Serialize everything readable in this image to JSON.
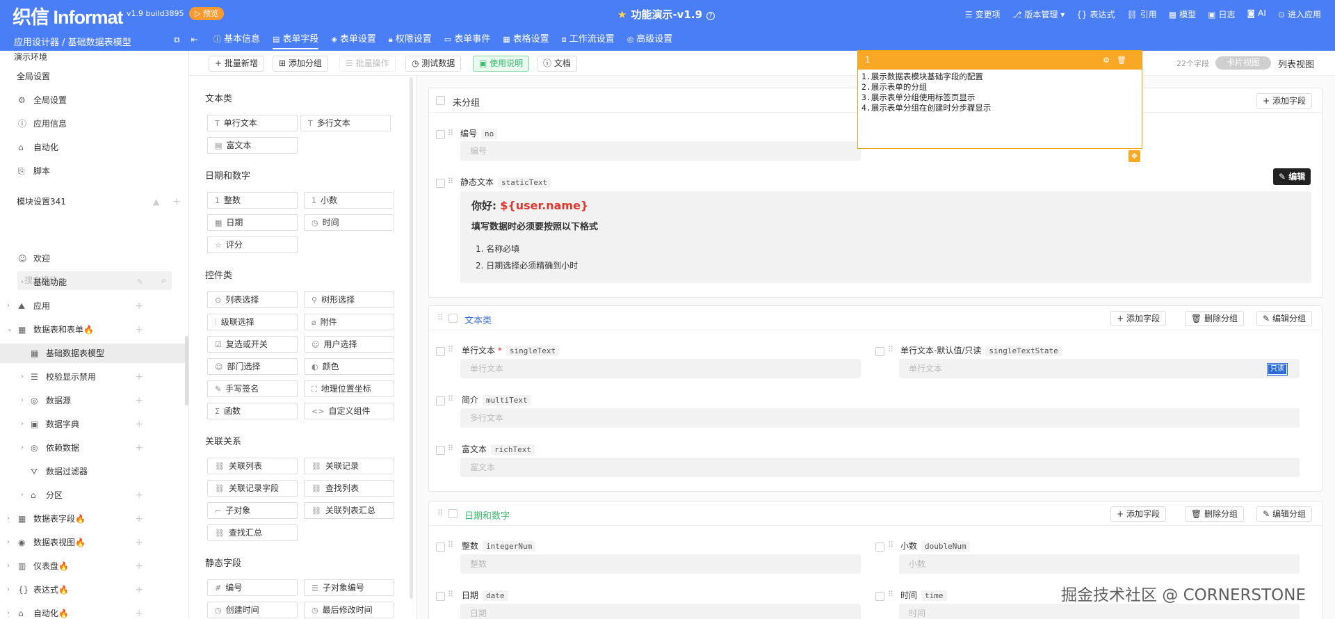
{
  "header": {
    "logo": "织信 Informat",
    "version": "v1.9 build3895",
    "preview_badge": "▷ 预览",
    "center_title": "功能演示-v1.9",
    "nav": [
      "变更项",
      "版本管理 ▾",
      "表达式",
      "引用",
      "模型",
      "日志",
      "AI",
      "进入应用"
    ]
  },
  "subbar": {
    "breadcrumb": "应用设计器 / 基础数据表模型",
    "tabs": [
      "基本信息",
      "表单字段",
      "表单设置",
      "权限设置",
      "表单事件",
      "表格设置",
      "工作流设置",
      "高级设置"
    ]
  },
  "sidebar": {
    "env": "演示环境",
    "global_settings": "全局设置",
    "global_items": [
      "全局设置",
      "应用信息",
      "自动化",
      "脚本"
    ],
    "module_settings": "模块设置341",
    "search_placeholder": "搜索模块",
    "modules": [
      {
        "label": "欢迎"
      },
      {
        "label": "基础功能"
      },
      {
        "label": "应用"
      },
      {
        "label": "数据表和表单🔥"
      },
      {
        "label": "基础数据表模型"
      },
      {
        "label": "校验显示禁用"
      },
      {
        "label": "数据源"
      },
      {
        "label": "数据字典"
      },
      {
        "label": "依赖数据"
      },
      {
        "label": "数据过滤器"
      },
      {
        "label": "分区"
      },
      {
        "label": "数据表字段🔥"
      },
      {
        "label": "数据表视图🔥"
      },
      {
        "label": "仪表盘🔥"
      },
      {
        "label": "表达式🔥"
      },
      {
        "label": "自动化🔥"
      }
    ]
  },
  "toolbar": {
    "batch_add": "+ 批量新增",
    "add_group": "添加分组",
    "batch_op": "批量操作",
    "test_data": "测试数据",
    "usage": "使用说明",
    "docs": "文档",
    "field_count": "22个字段",
    "card_view": "卡片视图",
    "list_view": "列表视图"
  },
  "palette": {
    "sections": [
      {
        "title": "文本类",
        "items": [
          "单行文本",
          "多行文本",
          "富文本"
        ]
      },
      {
        "title": "日期和数字",
        "items": [
          "整数",
          "小数",
          "日期",
          "时间",
          "评分"
        ]
      },
      {
        "title": "控件类",
        "items": [
          "列表选择",
          "树形选择",
          "级联选择",
          "附件",
          "复选或开关",
          "用户选择",
          "部门选择",
          "颜色",
          "手写签名",
          "地理位置坐标",
          "函数",
          "自定义组件"
        ]
      },
      {
        "title": "关联关系",
        "items": [
          "关联列表",
          "关联记录",
          "关联记录字段",
          "查找列表",
          "子对象",
          "关联列表汇总",
          "查找汇总"
        ]
      },
      {
        "title": "静态字段",
        "items": [
          "编号",
          "子对象编号",
          "创建时间",
          "最后修改时间"
        ]
      }
    ]
  },
  "canvas": {
    "ungrouped": {
      "title": "未分组",
      "add_field": "添加字段",
      "no_label": "编号",
      "no_code": "no",
      "no_placeholder": "编号",
      "static_label": "静态文本",
      "static_code": "staticText",
      "static_hello": "你好:",
      "static_var": "${user.name}",
      "static_line": "填写数据时必须要按照以下格式",
      "static_list": [
        "名称必填",
        "日期选择必须精确到小时"
      ]
    },
    "text_group": {
      "title": "文本类",
      "add_field": "添加字段",
      "delete_group": "删除分组",
      "edit_group": "编辑分组",
      "fields": [
        {
          "label": "单行文本",
          "code": "singleText",
          "placeholder": "单行文本"
        },
        {
          "label": "单行文本-默认值/只读",
          "code": "singleTextState",
          "placeholder": "单行文本",
          "badge": "只读"
        },
        {
          "label": "简介",
          "code": "multiText",
          "placeholder": "多行文本"
        },
        {
          "label": "富文本",
          "code": "richText",
          "placeholder": "富文本"
        }
      ]
    },
    "date_group": {
      "title": "日期和数字",
      "add_field": "添加字段",
      "delete_group": "删除分组",
      "edit_group": "编辑分组",
      "fields": [
        {
          "label": "整数",
          "code": "integerNum",
          "placeholder": "整数"
        },
        {
          "label": "小数",
          "code": "doubleNum",
          "placeholder": "小数"
        },
        {
          "label": "日期",
          "code": "date",
          "placeholder": "日期"
        },
        {
          "label": "时间",
          "code": "time",
          "placeholder": "时间"
        }
      ]
    }
  },
  "note": {
    "title": "1",
    "lines": [
      "1.展示数据表模块基础字段的配置",
      "2.展示表单的分组",
      "3.展示表单分组使用标签页显示",
      "4.展示表单分组在创建时分步骤显示"
    ]
  },
  "edit_tip": "编辑",
  "watermark": "掘金技术社区 @ CORNERSTONE",
  "colors": {
    "primary": "#4a7ef7",
    "accent": "#f9a825",
    "green": "#3dbb6e",
    "red": "#e03a2f"
  }
}
